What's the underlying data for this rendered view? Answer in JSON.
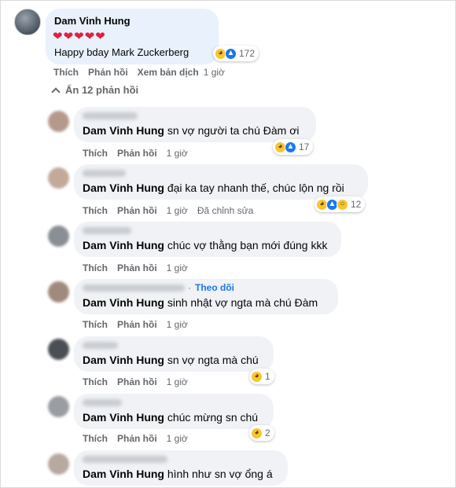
{
  "top_comment": {
    "author": "Dam Vinh Hung",
    "hearts": "❤❤❤❤❤",
    "text": "Happy bday Mark Zuckerberg",
    "reaction_count": "172",
    "actions": {
      "like": "Thích",
      "reply": "Phản hồi",
      "translate": "Xem bản dịch",
      "time": "1 giờ"
    }
  },
  "hide_replies_label": "Ẩn 12 phản hồi",
  "replies": [
    {
      "author": "Dam Vinh Hung",
      "text": "sn vợ người ta chú Đàm ơi",
      "reaction_count": "17",
      "like": "Thích",
      "reply": "Phản hồi",
      "time": "1 giờ",
      "edited": ""
    },
    {
      "author": "Dam Vinh Hung",
      "text": "đại ka tay nhanh thế, chúc lộn ng rồi",
      "reaction_count": "12",
      "like": "Thích",
      "reply": "Phản hồi",
      "time": "1 giờ",
      "edited": "Đã chỉnh sửa"
    },
    {
      "author": "Dam Vinh Hung",
      "text": "chúc vợ thằng bạn mới đúng kkk",
      "reaction_count": "",
      "like": "Thích",
      "reply": "Phản hồi",
      "time": "1 giờ",
      "edited": ""
    },
    {
      "author": "Dam Vinh Hung",
      "text": "sinh nhật vợ ngta mà chú Đàm",
      "reaction_count": "",
      "like": "Thích",
      "reply": "Phản hồi",
      "time": "1 giờ",
      "edited": "",
      "follow": "Theo dõi"
    },
    {
      "author": "Dam Vinh Hung",
      "text": "sn vợ ngta mà chú",
      "reaction_count": "1",
      "like": "Thích",
      "reply": "Phản hồi",
      "time": "1 giờ",
      "edited": ""
    },
    {
      "author": "Dam Vinh Hung",
      "text": "chúc mừng sn chú",
      "reaction_count": "2",
      "like": "Thích",
      "reply": "Phản hồi",
      "time": "1 giờ",
      "edited": ""
    },
    {
      "author": "Dam Vinh Hung",
      "text": "hình như sn vợ ổng á",
      "reaction_count": "",
      "like": "",
      "reply": "",
      "time": "",
      "edited": ""
    }
  ],
  "icons": {
    "haha": "😆",
    "like": "👍",
    "wow": "😮"
  },
  "colors": {
    "bubble_top": "#e8f1fc",
    "bubble_reply": "#f0f2f5",
    "link_blue": "#1877f2",
    "muted": "#65676b"
  }
}
